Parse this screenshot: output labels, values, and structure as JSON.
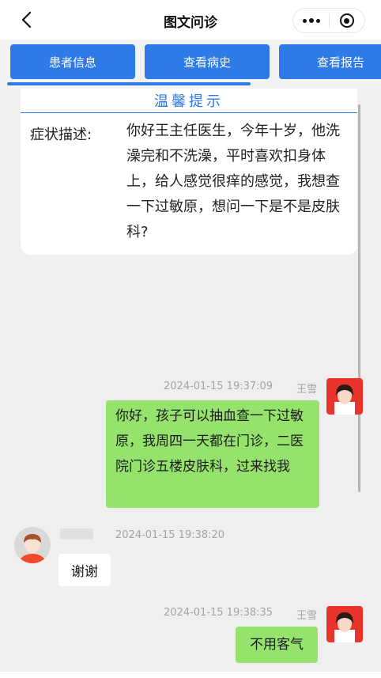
{
  "nav": {
    "title": "图文问诊",
    "back_icon": "chevron-left-icon",
    "more_icon": "more-dots-icon",
    "close_icon": "target-close-icon"
  },
  "tabs": [
    {
      "label": "患者信息"
    },
    {
      "label": "查看病史"
    },
    {
      "label": "查看报告"
    }
  ],
  "tip": {
    "title": "温馨提示",
    "label": "症状描述:",
    "content": "你好王主任医生，今年十岁，他洗澡完和不洗澡，平时喜欢扣身体上，给人感觉很痒的感觉，我想查一下过敏原，想问一下是不是皮肤科?"
  },
  "messages": [
    {
      "side": "right",
      "time": "2024-01-15 19:37:09",
      "sender": "王雪",
      "text": "你好，孩子可以抽血查一下过敏原，我周四一天都在门诊，二医院门诊五楼皮肤科，过来找我"
    },
    {
      "side": "left",
      "time": "2024-01-15 19:38:20",
      "sender": "",
      "text": "谢谢"
    },
    {
      "side": "right",
      "time": "2024-01-15 19:38:35",
      "sender": "王雪",
      "text": "不用客气"
    }
  ],
  "colors": {
    "primary": "#2e7be8",
    "bubble_self": "#95e36d",
    "chat_bg": "#efefef",
    "doctor_avatar_bg": "#e8342b"
  }
}
